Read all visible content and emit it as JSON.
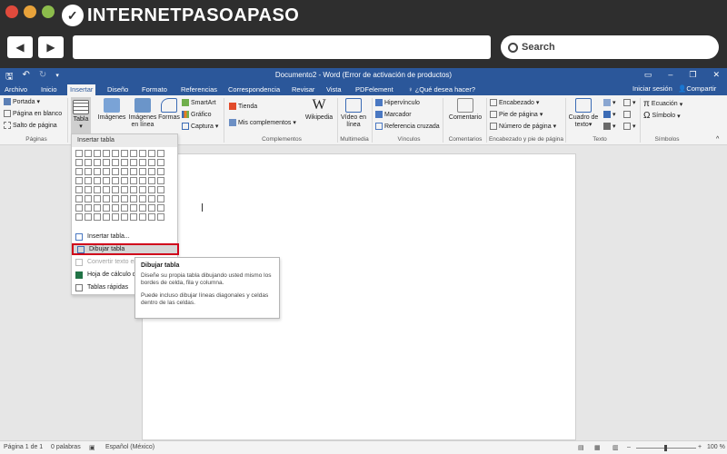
{
  "browser": {
    "logo_text": "INTERNETPASOAPASO",
    "search_label": "Search"
  },
  "word": {
    "title": "Documento2 - Word (Error de activación de productos)",
    "tabs": [
      "Archivo",
      "Inicio",
      "Insertar",
      "Diseño",
      "Formato",
      "Referencias",
      "Correspondencia",
      "Revisar",
      "Vista",
      "PDFelement"
    ],
    "tell_me": "¿Qué desea hacer?",
    "signin": "Iniciar sesión",
    "share": "Compartir"
  },
  "ribbon": {
    "paginas": {
      "items": [
        "Portada",
        "Página en blanco",
        "Salto de página"
      ],
      "label": "Páginas"
    },
    "tablas": {
      "tabla": "Tabla"
    },
    "ilustraciones": {
      "imagenes": "Imágenes",
      "imagenes_linea": "Imágenes en línea",
      "formas": "Formas",
      "smartart": "SmartArt",
      "grafico": "Gráfico",
      "captura": "Captura"
    },
    "complementos": {
      "tienda": "Tienda",
      "mis": "Mis complementos",
      "wikipedia": "Wikipedia",
      "label": "Complementos"
    },
    "multimedia": {
      "video": "Vídeo en línea",
      "label": "Multimedia"
    },
    "vinculos": {
      "items": [
        "Hipervínculo",
        "Marcador",
        "Referencia cruzada"
      ],
      "label": "Vínculos"
    },
    "comentarios": {
      "comentario": "Comentario",
      "label": "Comentarios"
    },
    "encabezado": {
      "items": [
        "Encabezado",
        "Pie de página",
        "Número de página"
      ],
      "label": "Encabezado y pie de página"
    },
    "texto": {
      "cuadro": "Cuadro de texto",
      "label": "Texto"
    },
    "simbolos": {
      "items": [
        "Ecuación",
        "Símbolo"
      ],
      "label": "Símbolos"
    }
  },
  "table_dropdown": {
    "header": "Insertar tabla",
    "grid_cols": 10,
    "grid_rows": 8,
    "menu": [
      {
        "label": "Insertar tabla...",
        "state": "normal"
      },
      {
        "label": "Dibujar tabla",
        "state": "highlighted"
      },
      {
        "label": "Convertir texto en",
        "state": "disabled"
      },
      {
        "label": "Hoja de cálculo de",
        "state": "normal"
      },
      {
        "label": "Tablas rápidas",
        "state": "normal"
      }
    ]
  },
  "tooltip": {
    "title": "Dibujar tabla",
    "p1": "Diseñe su propia tabla dibujando usted mismo los bordes de celda, fila y columna.",
    "p2": "Puede incluso dibujar líneas diagonales y celdas dentro de las celdas."
  },
  "status": {
    "page": "Página 1 de 1",
    "words": "0 palabras",
    "lang": "Español (México)",
    "zoom": "100 %"
  },
  "colors": {
    "word_blue": "#2b579a",
    "highlight_border": "#d0021b"
  }
}
